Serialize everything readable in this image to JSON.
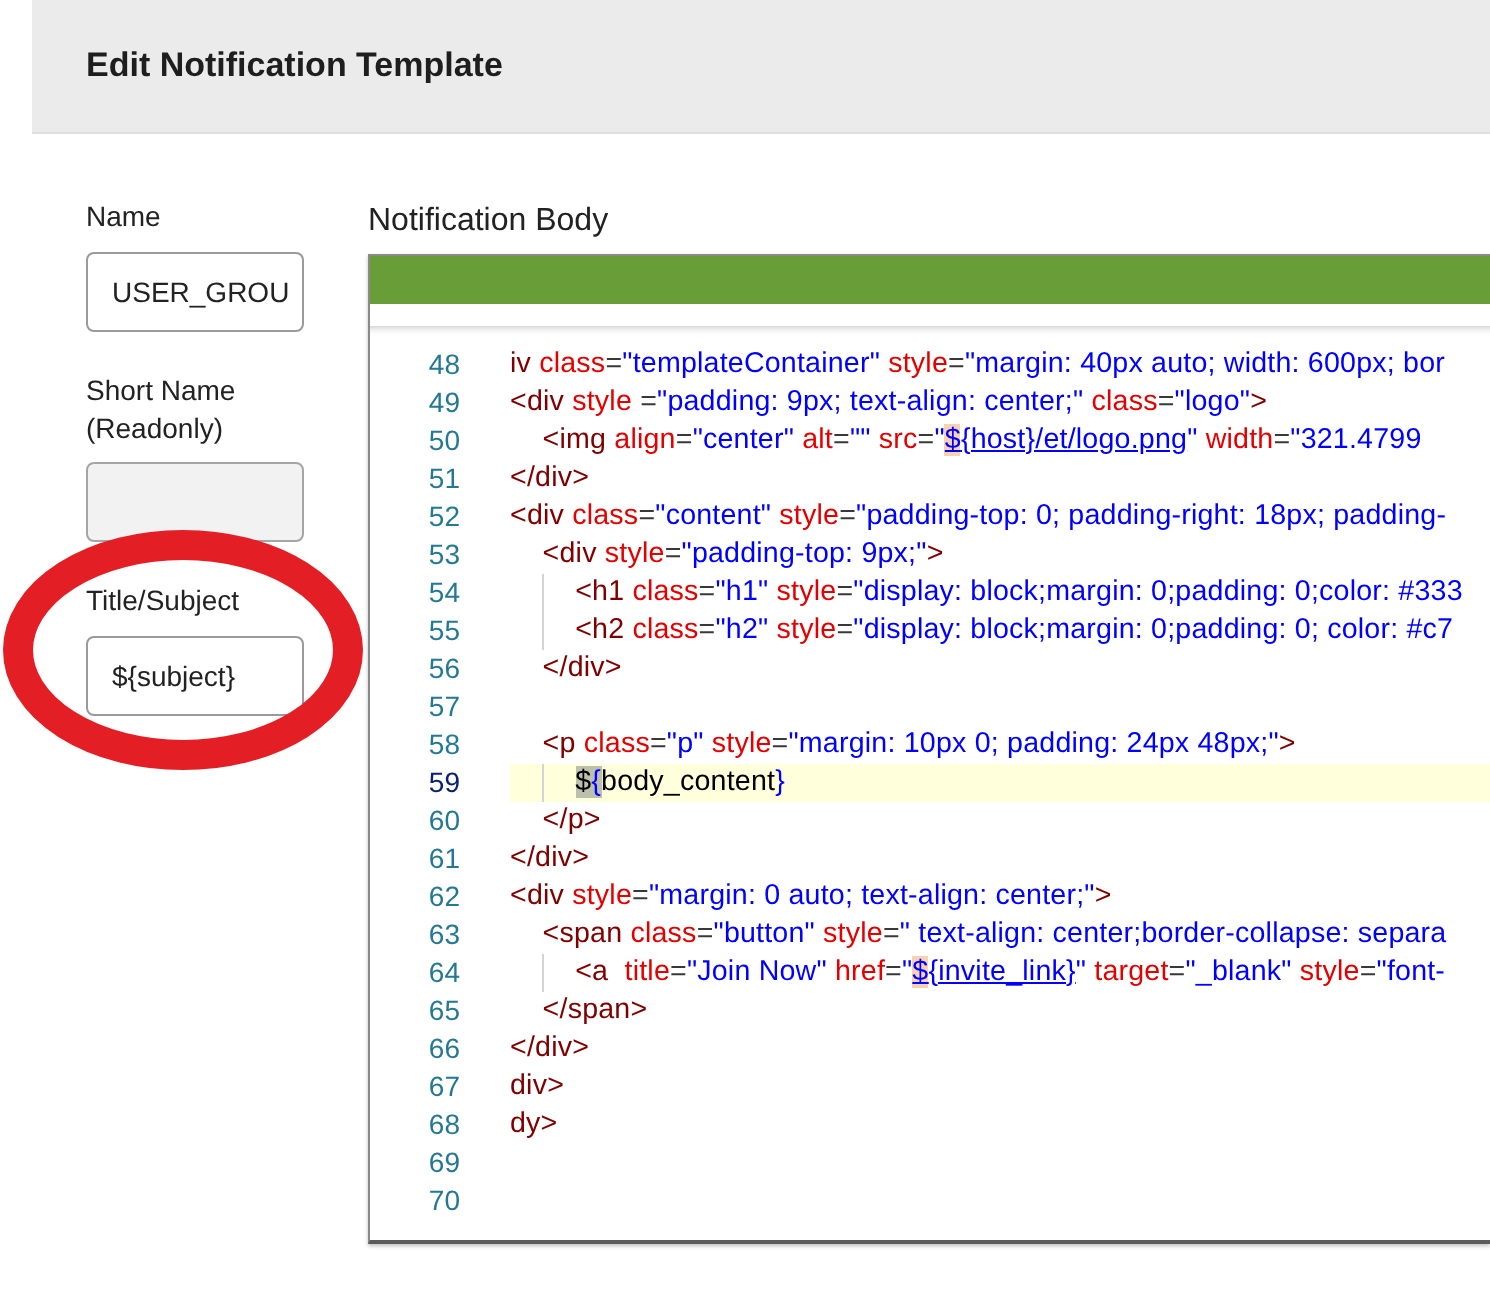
{
  "page": {
    "title": "Edit Notification Template"
  },
  "fields": [
    {
      "label": "Name",
      "value": "USER_GROU",
      "readonly": false,
      "highlighted": false
    },
    {
      "label": "Short Name (Readonly)",
      "readonly": true,
      "highlighted": false
    },
    {
      "label": "Title/Subject",
      "value": "${subject}",
      "readonly": false,
      "highlighted": true
    }
  ],
  "editor": {
    "label": "Notification Body",
    "lines": [
      {
        "number": "48",
        "active": false,
        "tokens": [
          {
            "text": "iv ",
            "kind": "tag"
          },
          {
            "text": "class",
            "kind": "attr"
          },
          {
            "text": "=",
            "kind": "punct"
          },
          {
            "text": "\"templateContainer\" ",
            "kind": "string"
          },
          {
            "text": "style",
            "kind": "attr"
          },
          {
            "text": "=",
            "kind": "punct"
          },
          {
            "text": "\"margin: 40px auto; width: 600px; bor",
            "kind": "string"
          }
        ]
      },
      {
        "number": "49",
        "active": false,
        "tokens": [
          {
            "text": "<div ",
            "kind": "tag"
          },
          {
            "text": "style ",
            "kind": "attr"
          },
          {
            "text": "=",
            "kind": "punct"
          },
          {
            "text": "\"padding: 9px; text-align: center;\" ",
            "kind": "string"
          },
          {
            "text": "class",
            "kind": "attr"
          },
          {
            "text": "=",
            "kind": "punct"
          },
          {
            "text": "\"logo\"",
            "kind": "string"
          },
          {
            "text": ">",
            "kind": "tag"
          }
        ]
      },
      {
        "number": "50",
        "active": false,
        "tokens": [
          {
            "text": "    <img ",
            "kind": "tag"
          },
          {
            "text": "align",
            "kind": "attr"
          },
          {
            "text": "=",
            "kind": "punct"
          },
          {
            "text": "\"center\" ",
            "kind": "string"
          },
          {
            "text": "alt",
            "kind": "attr"
          },
          {
            "text": "=",
            "kind": "punct"
          },
          {
            "text": "\"\" ",
            "kind": "string"
          },
          {
            "text": "src",
            "kind": "attr"
          },
          {
            "text": "=",
            "kind": "punct"
          },
          {
            "text": "\"",
            "kind": "string"
          },
          {
            "text": "$",
            "kind": "sigil"
          },
          {
            "text": "{host}/et/logo.png",
            "kind": "link"
          },
          {
            "text": "\" ",
            "kind": "string"
          },
          {
            "text": "width",
            "kind": "attr"
          },
          {
            "text": "=",
            "kind": "punct"
          },
          {
            "text": "\"321.4799",
            "kind": "string"
          }
        ]
      },
      {
        "number": "51",
        "active": false,
        "tokens": [
          {
            "text": "</div>",
            "kind": "tag"
          }
        ]
      },
      {
        "number": "52",
        "active": false,
        "tokens": [
          {
            "text": "<div ",
            "kind": "tag"
          },
          {
            "text": "class",
            "kind": "attr"
          },
          {
            "text": "=",
            "kind": "punct"
          },
          {
            "text": "\"content\" ",
            "kind": "string"
          },
          {
            "text": "style",
            "kind": "attr"
          },
          {
            "text": "=",
            "kind": "punct"
          },
          {
            "text": "\"padding-top: 0; padding-right: 18px; padding-",
            "kind": "string"
          }
        ]
      },
      {
        "number": "53",
        "active": false,
        "tokens": [
          {
            "text": "    <div ",
            "kind": "tag"
          },
          {
            "text": "style",
            "kind": "attr"
          },
          {
            "text": "=",
            "kind": "punct"
          },
          {
            "text": "\"padding-top: 9px;\"",
            "kind": "string"
          },
          {
            "text": ">",
            "kind": "tag"
          }
        ]
      },
      {
        "number": "54",
        "active": false,
        "tokens": [
          {
            "text": "        <h1 ",
            "kind": "tag"
          },
          {
            "text": "class",
            "kind": "attr"
          },
          {
            "text": "=",
            "kind": "punct"
          },
          {
            "text": "\"h1\" ",
            "kind": "string"
          },
          {
            "text": "style",
            "kind": "attr"
          },
          {
            "text": "=",
            "kind": "punct"
          },
          {
            "text": "\"display: block;margin: 0;padding: 0;color: #333",
            "kind": "string"
          }
        ]
      },
      {
        "number": "55",
        "active": false,
        "tokens": [
          {
            "text": "        <h2 ",
            "kind": "tag"
          },
          {
            "text": "class",
            "kind": "attr"
          },
          {
            "text": "=",
            "kind": "punct"
          },
          {
            "text": "\"h2\" ",
            "kind": "string"
          },
          {
            "text": "style",
            "kind": "attr"
          },
          {
            "text": "=",
            "kind": "punct"
          },
          {
            "text": "\"display: block;margin: 0;padding: 0; color: #c7",
            "kind": "string"
          }
        ]
      },
      {
        "number": "56",
        "active": false,
        "tokens": [
          {
            "text": "    </div>",
            "kind": "tag"
          }
        ]
      },
      {
        "number": "57",
        "active": false
      },
      {
        "number": "58",
        "active": false,
        "tokens": [
          {
            "text": "    <p ",
            "kind": "tag"
          },
          {
            "text": "class",
            "kind": "attr"
          },
          {
            "text": "=",
            "kind": "punct"
          },
          {
            "text": "\"p\" ",
            "kind": "string"
          },
          {
            "text": "style",
            "kind": "attr"
          },
          {
            "text": "=",
            "kind": "punct"
          },
          {
            "text": "\"margin: 10px 0; padding: 24px 48px;\"",
            "kind": "string"
          },
          {
            "text": ">",
            "kind": "tag"
          }
        ]
      },
      {
        "number": "59",
        "active": true,
        "tokens": [
          {
            "text": "        $",
            "kind": "match"
          },
          {
            "text": "{",
            "kind": "brace-match"
          },
          {
            "text": "body_content",
            "kind": "text"
          },
          {
            "text": "}",
            "kind": "brace"
          }
        ]
      },
      {
        "number": "60",
        "active": false,
        "tokens": [
          {
            "text": "    </p>",
            "kind": "tag"
          }
        ]
      },
      {
        "number": "61",
        "active": false,
        "tokens": [
          {
            "text": "</div>",
            "kind": "tag"
          }
        ]
      },
      {
        "number": "62",
        "active": false,
        "tokens": [
          {
            "text": "<div ",
            "kind": "tag"
          },
          {
            "text": "style",
            "kind": "attr"
          },
          {
            "text": "=",
            "kind": "punct"
          },
          {
            "text": "\"margin: 0 auto; text-align: center;\"",
            "kind": "string"
          },
          {
            "text": ">",
            "kind": "tag"
          }
        ]
      },
      {
        "number": "63",
        "active": false,
        "tokens": [
          {
            "text": "    <span ",
            "kind": "tag"
          },
          {
            "text": "class",
            "kind": "attr"
          },
          {
            "text": "=",
            "kind": "punct"
          },
          {
            "text": "\"button\" ",
            "kind": "string"
          },
          {
            "text": "style",
            "kind": "attr"
          },
          {
            "text": "=",
            "kind": "punct"
          },
          {
            "text": "\" text-align: center;border-collapse: separa",
            "kind": "string"
          }
        ]
      },
      {
        "number": "64",
        "active": false,
        "tokens": [
          {
            "text": "        <a  ",
            "kind": "tag"
          },
          {
            "text": "title",
            "kind": "attr"
          },
          {
            "text": "=",
            "kind": "punct"
          },
          {
            "text": "\"Join Now\" ",
            "kind": "string"
          },
          {
            "text": "href",
            "kind": "attr"
          },
          {
            "text": "=",
            "kind": "punct"
          },
          {
            "text": "\"",
            "kind": "string"
          },
          {
            "text": "$",
            "kind": "sigil"
          },
          {
            "text": "{invite_link}",
            "kind": "link"
          },
          {
            "text": "\" ",
            "kind": "string"
          },
          {
            "text": "target",
            "kind": "attr"
          },
          {
            "text": "=",
            "kind": "punct"
          },
          {
            "text": "\"_blank\" ",
            "kind": "string"
          },
          {
            "text": "style",
            "kind": "attr"
          },
          {
            "text": "=",
            "kind": "punct"
          },
          {
            "text": "\"font-",
            "kind": "string"
          }
        ]
      },
      {
        "number": "65",
        "active": false,
        "tokens": [
          {
            "text": "    </span>",
            "kind": "tag"
          }
        ]
      },
      {
        "number": "66",
        "active": false,
        "tokens": [
          {
            "text": "</div>",
            "kind": "tag"
          }
        ]
      },
      {
        "number": "67",
        "active": false,
        "tokens": [
          {
            "text": "div>",
            "kind": "tag"
          }
        ]
      },
      {
        "number": "68",
        "active": false,
        "tokens": [
          {
            "text": "dy>",
            "kind": "tag"
          }
        ]
      },
      {
        "number": "69",
        "active": false
      },
      {
        "number": "70",
        "active": false
      }
    ]
  }
}
